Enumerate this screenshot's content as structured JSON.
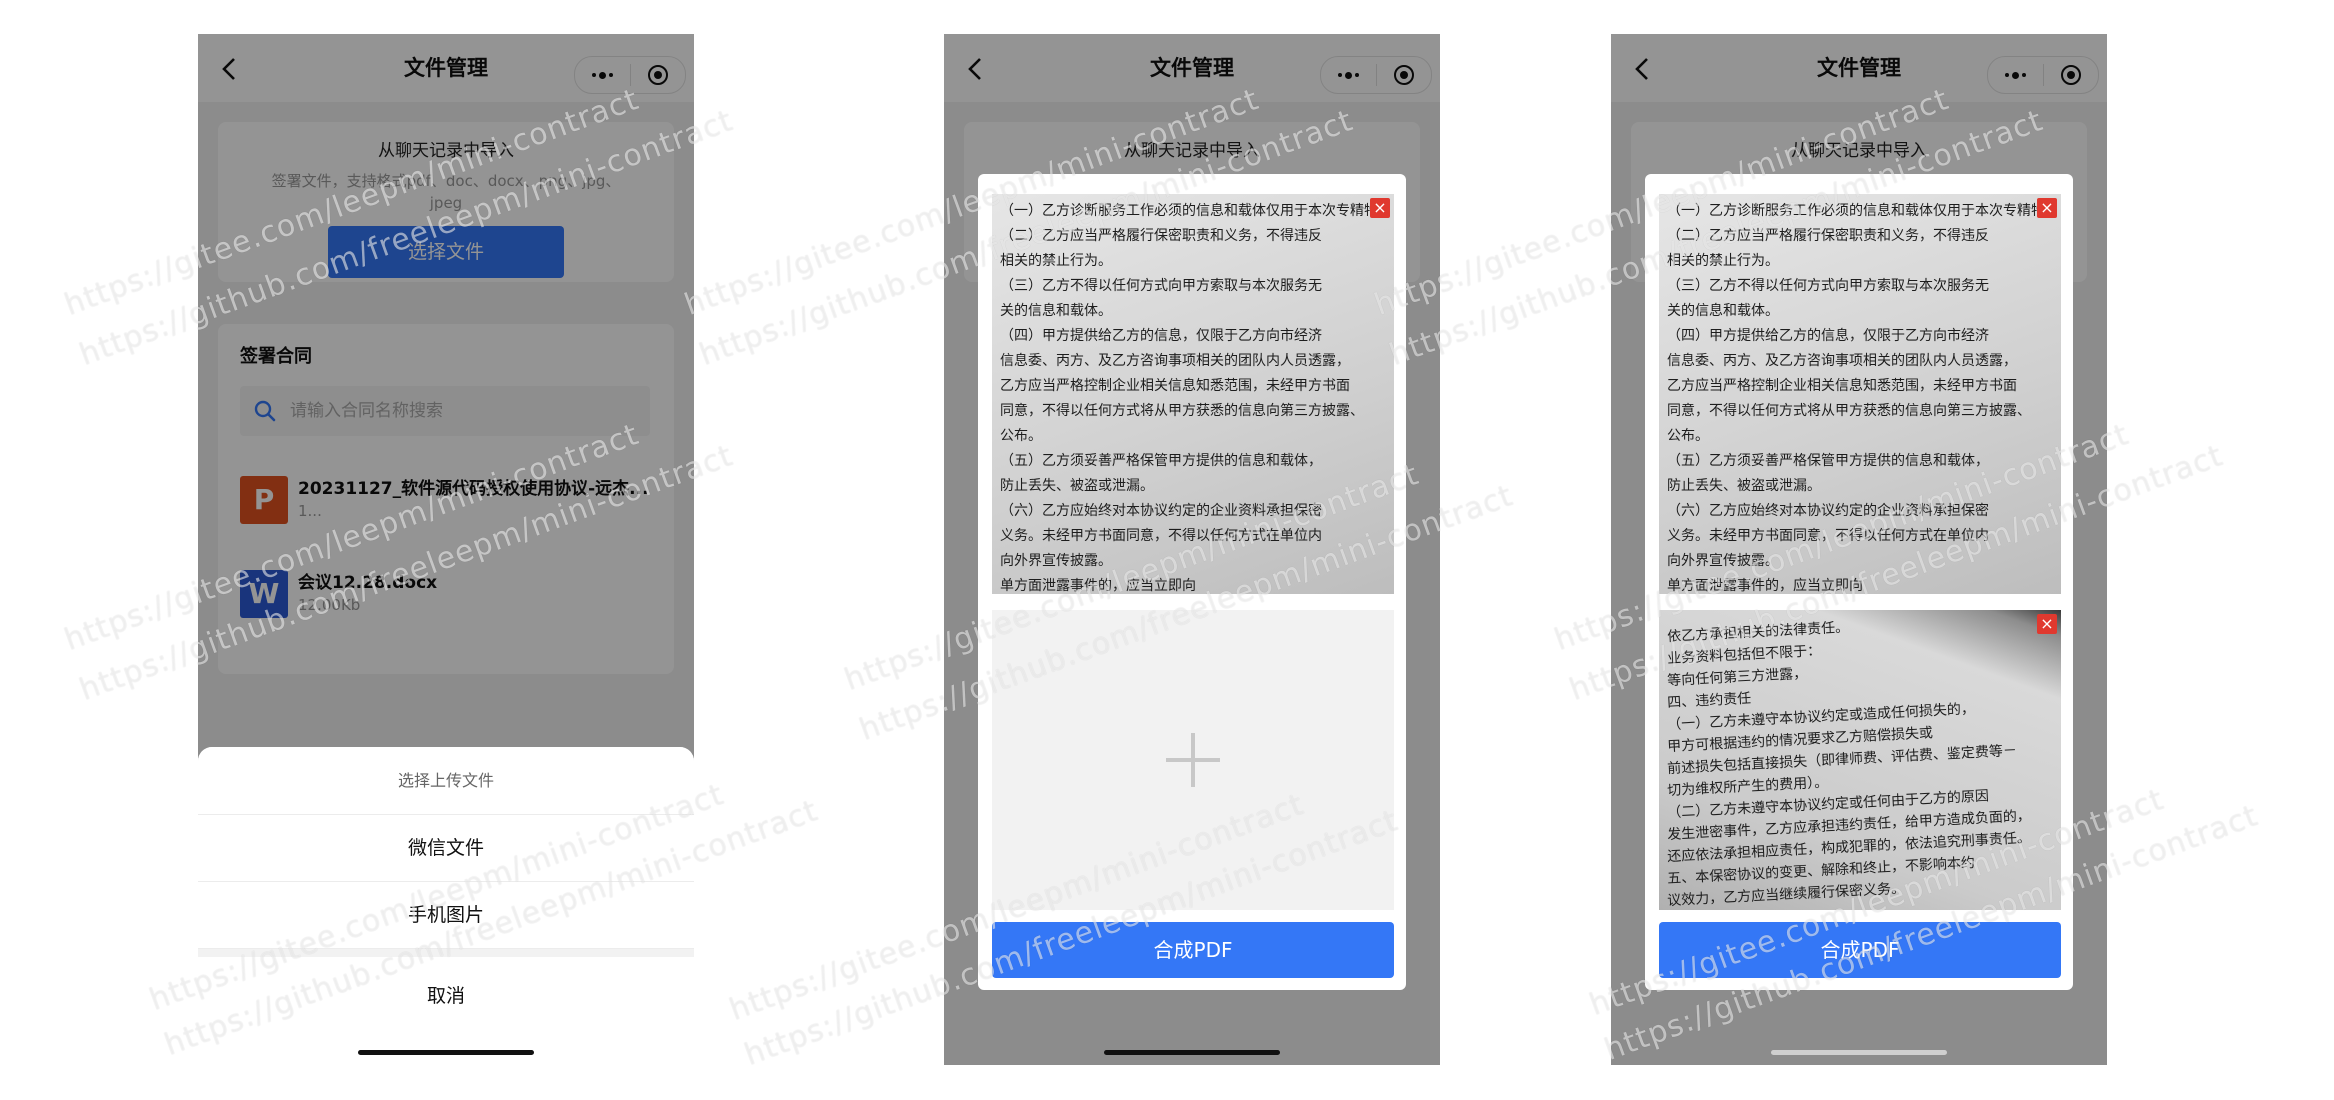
{
  "nav": {
    "title": "文件管理"
  },
  "import": {
    "title": "从聊天记录中导入",
    "hint": "签署文件，支持格式pdf、doc、docx、png、jpg、jpeg",
    "button": "选择文件"
  },
  "sign": {
    "title": "签署合同",
    "search_placeholder": "请输入合同名称搜索",
    "files": [
      {
        "name": "20231127_软件源代码授权使用协议-远杰...",
        "size": "1...",
        "icon": "ppt-file-icon"
      },
      {
        "name": "会议12.28.docx",
        "size": "12.00Kb",
        "icon": "word-file-icon"
      }
    ]
  },
  "sheet": {
    "title": "选择上传文件",
    "items": [
      "微信文件",
      "手机图片"
    ],
    "cancel": "取消"
  },
  "modal": {
    "merge_button": "合成PDF",
    "delete_glyph": "×",
    "doc_page_1": [
      "（一）乙方诊断服务工作必须的信息和载体仅用于本次专精特新中",
      "（二）乙方应当严格履行保密职责和义务，不得违反",
      "相关的禁止行为。",
      "（三）乙方不得以任何方式向甲方索取与本次服务无",
      "关的信息和载体。",
      "（四）甲方提供给乙方的信息，仅限于乙方向市经济",
      "信息委、丙方、及乙方咨询事项相关的团队内人员透露，",
      "乙方应当严格控制企业相关信息知悉范围，未经甲方书面",
      "同意，不得以任何方式将从甲方获悉的信息向第三方披露、",
      "公布。",
      "（五）乙方须妥善严格保管甲方提供的信息和载体，",
      "防止丢失、被盗或泄漏。",
      "（六）乙方应始终对本协议约定的企业资料承担保密",
      "义务。未经甲方书面同意，不得以任何方式在单位内",
      "向外界宣传披露。",
      "单方面泄露事件的，应当立即向"
    ],
    "doc_page_2": [
      "依乙方承担相关的法律责任。",
      "业务资料包括但不限于：",
      "等向任何第三方泄露，",
      "四、违约责任",
      "（一）乙方未遵守本协议约定或造成任何损失的，",
      "甲方可根据违约的情况要求乙方赔偿损失或",
      "前述损失包括直接损失（即律师费、评估费、鉴定费等－",
      "切为维权所产生的费用）。",
      "（二）乙方未遵守本协议约定或任何由于乙方的原因",
      "发生泄密事件，乙方应承担违约责任，给甲方造成负面的，",
      "还应依法承担相应责任，构成犯罪的，依法追究刑事责任。",
      "五、本保密协议的变更、解除和终止，不影响本约",
      "议效力，乙方应当继续履行保密义务。"
    ]
  },
  "watermark": {
    "line1": "https://gitee.com/leepm/mini-contract",
    "line2": "https://github.com/freeleepm/mini-contract"
  },
  "colors": {
    "primary": "#3477f6",
    "ppt": "#e0521f",
    "word": "#2c5bd6",
    "delete": "#e0392f"
  }
}
